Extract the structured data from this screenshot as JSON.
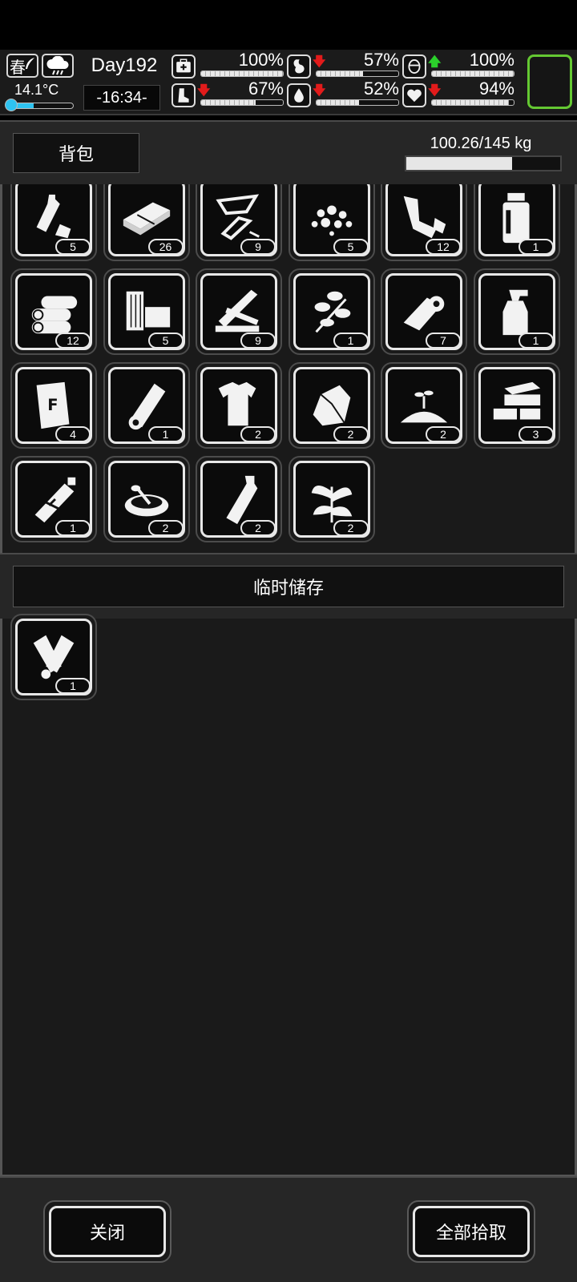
{
  "status": {
    "season": "春",
    "temperature": "14.1°C",
    "temperature_level": 0.4,
    "day": "Day192",
    "time": "-16:34-",
    "stats": [
      {
        "name": "health",
        "icon": "medkit-icon",
        "value": "100%",
        "level": 1.0,
        "trend": "none"
      },
      {
        "name": "hunger",
        "icon": "stomach-icon",
        "value": "57%",
        "level": 0.57,
        "trend": "down"
      },
      {
        "name": "mood",
        "icon": "head-icon",
        "value": "100%",
        "level": 1.0,
        "trend": "up"
      },
      {
        "name": "stamina",
        "icon": "boot-icon",
        "value": "67%",
        "level": 0.67,
        "trend": "down"
      },
      {
        "name": "thirst",
        "icon": "water-drop-icon",
        "value": "52%",
        "level": 0.52,
        "trend": "down"
      },
      {
        "name": "heart",
        "icon": "heart-icon",
        "value": "94%",
        "level": 0.94,
        "trend": "down"
      }
    ]
  },
  "backpack": {
    "title": "背包",
    "weight": "100.26/145 kg",
    "weight_level": 0.69,
    "items": [
      {
        "icon": "plastic-bottles-icon",
        "count": "5"
      },
      {
        "icon": "wood-plank-icon",
        "count": "26"
      },
      {
        "icon": "glass-shards-icon",
        "count": "9"
      },
      {
        "icon": "gravel-icon",
        "count": "5"
      },
      {
        "icon": "scrap-metal-icon",
        "count": "12"
      },
      {
        "icon": "glass-jar-icon",
        "count": "1"
      },
      {
        "icon": "logs-icon",
        "count": "12"
      },
      {
        "icon": "wood-blocks-icon",
        "count": "5"
      },
      {
        "icon": "boards-icon",
        "count": "9"
      },
      {
        "icon": "herb-branch-icon",
        "count": "1"
      },
      {
        "icon": "cloth-roll-icon",
        "count": "7"
      },
      {
        "icon": "spray-bottle-icon",
        "count": "1"
      },
      {
        "icon": "fertilizer-bag-icon",
        "count": "4"
      },
      {
        "icon": "paper-roll-icon",
        "count": "1"
      },
      {
        "icon": "torn-shirt-icon",
        "count": "2"
      },
      {
        "icon": "rock-icon",
        "count": "2"
      },
      {
        "icon": "seedling-soil-icon",
        "count": "2"
      },
      {
        "icon": "bricks-icon",
        "count": "3"
      },
      {
        "icon": "ointment-tube-icon",
        "count": "1"
      },
      {
        "icon": "bowl-icon",
        "count": "2"
      },
      {
        "icon": "bottle-icon",
        "count": "2"
      },
      {
        "icon": "leafy-plant-icon",
        "count": "2"
      }
    ]
  },
  "temp_storage": {
    "title": "临时储存",
    "items": [
      {
        "icon": "spray-cans-icon",
        "count": "1"
      }
    ]
  },
  "footer": {
    "close_label": "关闭",
    "pickup_all_label": "全部拾取"
  }
}
